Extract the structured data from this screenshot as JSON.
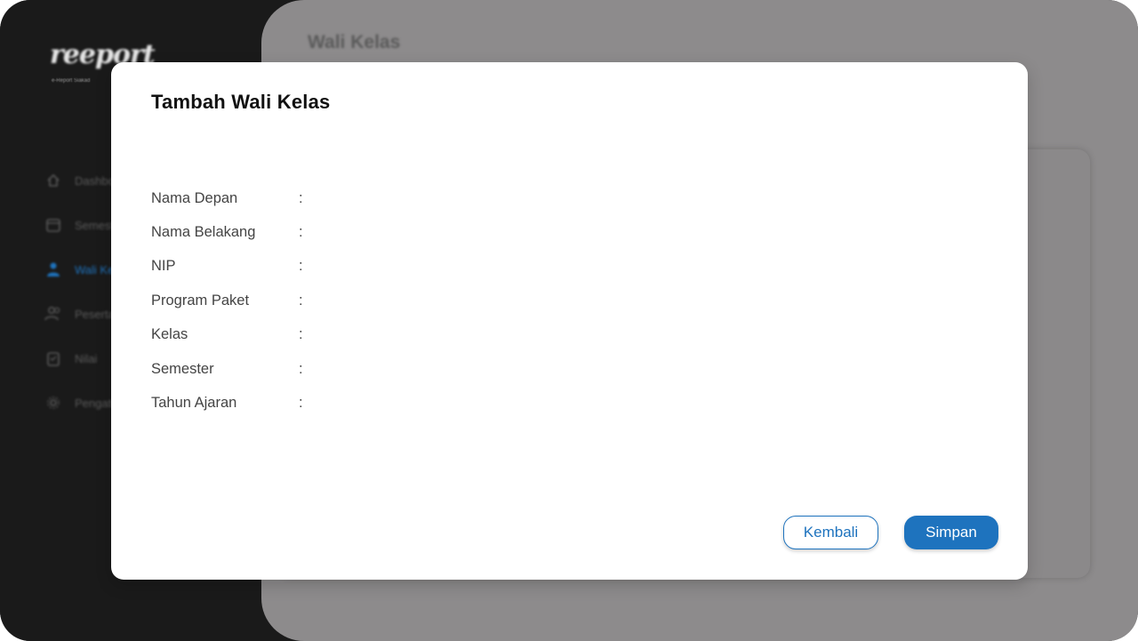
{
  "app": {
    "logo_text": "reeport",
    "logo_subtitle": "e-Report Siakad"
  },
  "sidebar": {
    "items": [
      {
        "label": "Dashboard",
        "icon": "home-icon",
        "active": false
      },
      {
        "label": "Semester",
        "icon": "calendar-icon",
        "active": false
      },
      {
        "label": "Wali Kelas",
        "icon": "person-icon",
        "active": true
      },
      {
        "label": "Peserta Didik",
        "icon": "people-icon",
        "active": false
      },
      {
        "label": "Nilai",
        "icon": "clipboard-icon",
        "active": false
      },
      {
        "label": "Pengaturan",
        "icon": "gear-icon",
        "active": false
      }
    ]
  },
  "main": {
    "title": "Wali Kelas"
  },
  "modal": {
    "title": "Tambah Wali Kelas",
    "fields": [
      {
        "label": "Nama Depan",
        "separator": ":"
      },
      {
        "label": "Nama Belakang",
        "separator": ":"
      },
      {
        "label": "NIP",
        "separator": ":"
      },
      {
        "label": "Program Paket",
        "separator": ":"
      },
      {
        "label": "Kelas",
        "separator": ":"
      },
      {
        "label": "Semester",
        "separator": ":"
      },
      {
        "label": "Tahun Ajaran",
        "separator": ":"
      }
    ],
    "buttons": {
      "back_label": "Kembali",
      "save_label": "Simpan"
    }
  },
  "colors": {
    "accent": "#1e73be",
    "sidebar_bg": "#1a1a1a",
    "backdrop": "#8d8b8c"
  }
}
